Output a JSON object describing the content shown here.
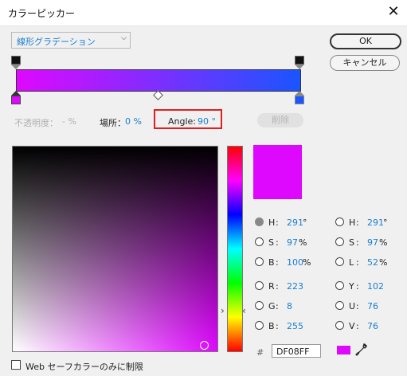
{
  "window": {
    "title": "カラーピッカー"
  },
  "gradient_type": "線形グラデーション",
  "buttons": {
    "ok": "OK",
    "cancel": "キャンセル",
    "delete": "削除"
  },
  "stops": {
    "opacity_label": "不透明度：",
    "opacity_value": "- %",
    "location_label": "場所：",
    "location_value": "0 %",
    "angle_label": "Angle:",
    "angle_value": "90 °"
  },
  "colors": {
    "current": "#df08ff",
    "end": "#1a55ff",
    "accent": "#1a7ed0",
    "highlight": "#e02020"
  },
  "fields_left": [
    {
      "label": "H",
      "value": "291",
      "unit": "°",
      "selected": true
    },
    {
      "label": "S",
      "value": "97",
      "unit": "%",
      "selected": false
    },
    {
      "label": "B",
      "value": "100",
      "unit": "%",
      "selected": false
    },
    {
      "label": "R",
      "value": "223",
      "unit": "",
      "selected": false
    },
    {
      "label": "G",
      "value": "8",
      "unit": "",
      "selected": false
    },
    {
      "label": "B",
      "value": "255",
      "unit": "",
      "selected": false
    }
  ],
  "fields_right": [
    {
      "label": "H",
      "value": "291",
      "unit": "°"
    },
    {
      "label": "S",
      "value": "97",
      "unit": "%"
    },
    {
      "label": "L",
      "value": "52",
      "unit": "%"
    },
    {
      "label": "Y",
      "value": "102",
      "unit": ""
    },
    {
      "label": "U",
      "value": "76",
      "unit": ""
    },
    {
      "label": "V",
      "value": "76",
      "unit": ""
    }
  ],
  "hex": {
    "prefix": "#",
    "value": "DF08FF"
  },
  "web_only_label": "Web セーフカラーのみに制限",
  "icons": {
    "close": "close-icon",
    "eyedropper": "eyedropper-icon",
    "chevron": "chevron-down-icon"
  }
}
